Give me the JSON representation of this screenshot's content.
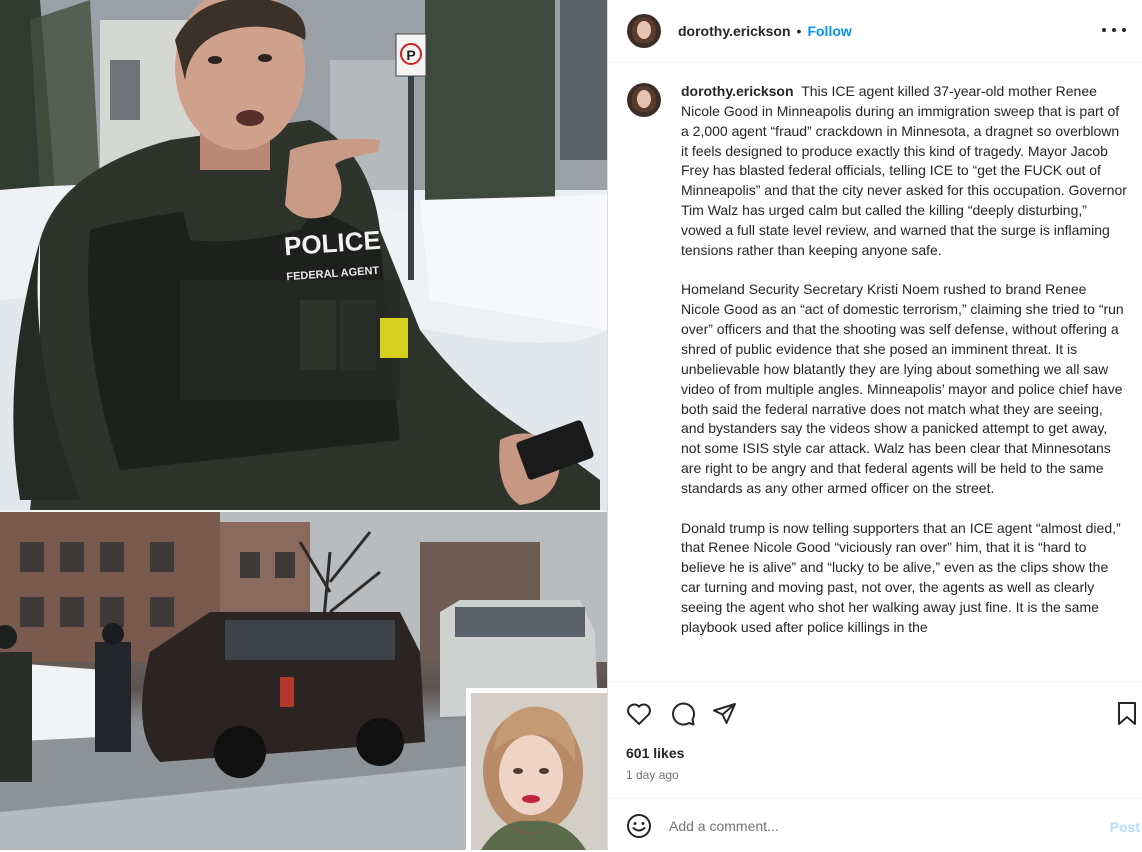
{
  "post": {
    "username": "dorothy.erickson",
    "follow_label": "Follow",
    "separator": "•",
    "caption_paragraphs": [
      "This ICE agent killed 37-year-old mother Renee Nicole Good in Minneapolis during an immigration sweep that is part of a 2,000 agent “fraud” crackdown in Minnesota, a dragnet so overblown it feels designed to produce exactly this kind of tragedy. Mayor Jacob Frey has blasted federal officials, telling ICE to “get the FUCK out of Minneapolis” and that the city never asked for this occupation. Governor Tim Walz has urged calm but called the killing “deeply disturbing,” vowed a full state level review, and warned that the surge is inflaming tensions rather than keeping anyone safe.",
      "Homeland Security Secretary Kristi Noem rushed to brand Renee Nicole Good as an “act of domestic terrorism,” claiming she tried to “run over” officers and that the shooting was self defense, without offering a shred of public evidence that she posed an imminent threat. It is unbelievable how blatantly they are lying about something we all saw video of from multiple angles. Minneapolis’ mayor and police chief have both said the federal narrative does not match what they are seeing, and bystanders say the videos show a panicked attempt to get away, not some ISIS style car attack. Walz has been clear that Minnesotans are right to be angry and that federal agents will be held to the same standards as any other armed officer on the street.",
      "Donald trump is now telling supporters that an ICE agent “almost died,” that Renee Nicole Good “viciously ran over” him, that it is “hard to believe he is alive” and “lucky to be alive,” even as the clips show the car turning and moving past, not over, the agents as well as clearly seeing the agent who shot her walking away just fine. It is the same playbook used after police killings in the"
    ],
    "media_text": {
      "vest_line1": "POLICE",
      "vest_line2": "FEDERAL AGENT"
    },
    "likes": "601 likes",
    "timestamp": "1 day ago",
    "comment_placeholder": "Add a comment...",
    "post_label": "Post",
    "icons": {
      "more": "more-options-icon",
      "like": "heart-icon",
      "comment": "comment-icon",
      "share": "send-icon",
      "save": "bookmark-icon",
      "emoji": "emoji-icon"
    },
    "colors": {
      "link": "#0095f6",
      "post_disabled": "#b2dffc",
      "text": "#262626",
      "muted": "#737373"
    }
  }
}
